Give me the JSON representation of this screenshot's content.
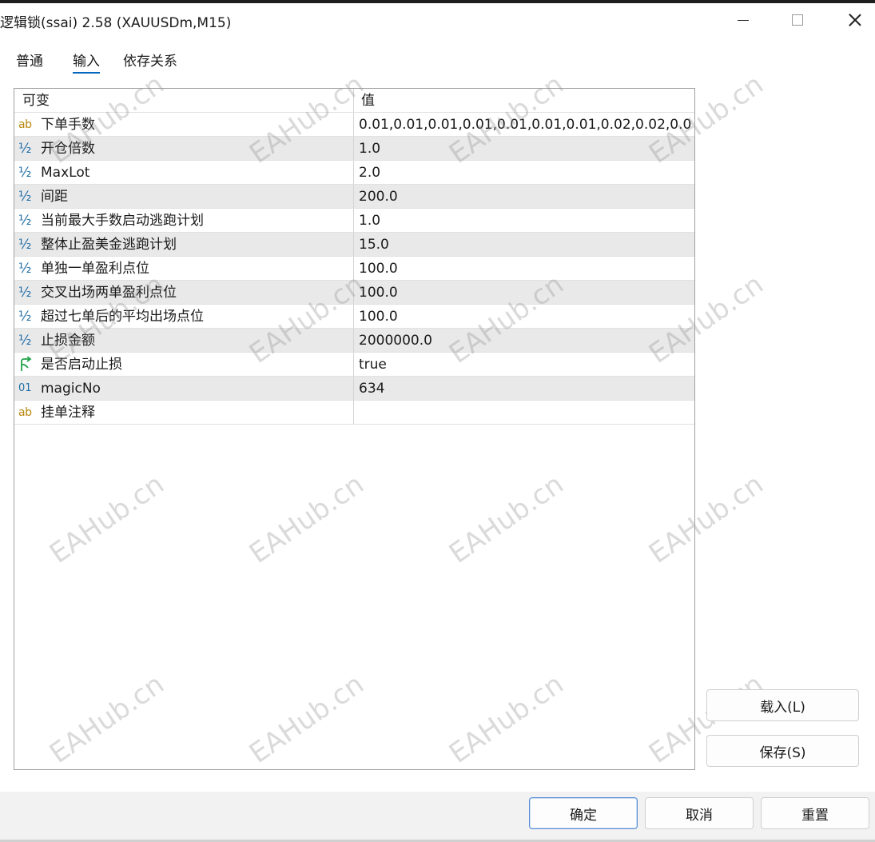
{
  "window": {
    "title": "逻辑锁(ssai) 2.58 (XAUUSDm,M15)"
  },
  "tabs": [
    {
      "label": "普通"
    },
    {
      "label": "输入"
    },
    {
      "label": "依存关系"
    }
  ],
  "active_tab": "输入",
  "table": {
    "headers": {
      "name": "可变",
      "value": "值"
    },
    "rows": [
      {
        "icon": "ab",
        "name": "下单手数",
        "value": "0.01,0.01,0.01,0.01,0.01,0.01,0.01,0.02,0.02,0.0..."
      },
      {
        "icon": "½",
        "name": "开仓倍数",
        "value": "1.0"
      },
      {
        "icon": "½",
        "name": "MaxLot",
        "value": "2.0"
      },
      {
        "icon": "½",
        "name": "间距",
        "value": "200.0"
      },
      {
        "icon": "½",
        "name": "当前最大手数启动逃跑计划",
        "value": "1.0"
      },
      {
        "icon": "½",
        "name": "整体止盈美金逃跑计划",
        "value": "15.0"
      },
      {
        "icon": "½",
        "name": "单独一单盈利点位",
        "value": "100.0"
      },
      {
        "icon": "½",
        "name": "交叉出场两单盈利点位",
        "value": "100.0"
      },
      {
        "icon": "½",
        "name": "超过七单后的平均出场点位",
        "value": "100.0"
      },
      {
        "icon": "½",
        "name": "止损金额",
        "value": "2000000.0"
      },
      {
        "icon": "bool",
        "name": "是否启动止损",
        "value": "true"
      },
      {
        "icon": "01",
        "name": "magicNo",
        "value": "634"
      },
      {
        "icon": "ab",
        "name": "挂单注释",
        "value": ""
      }
    ]
  },
  "side_buttons": {
    "load": "载入(L)",
    "save": "保存(S)"
  },
  "bottom_buttons": {
    "ok": "确定",
    "cancel": "取消",
    "reset": "重置"
  },
  "watermark": "EAHub.cn",
  "colors": {
    "accent": "#0067c0",
    "alt_row": "#e9e9e9",
    "icon_string": "#b8860b",
    "icon_number": "#1f6fa8",
    "icon_bool": "#22a34a"
  }
}
